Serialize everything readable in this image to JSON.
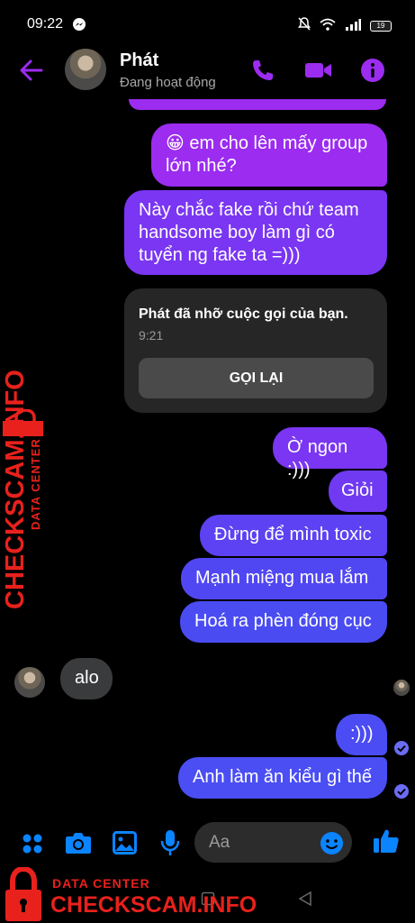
{
  "status_bar": {
    "time": "09:22",
    "battery": "19"
  },
  "header": {
    "contact_name": "Phát",
    "contact_status": "Đang hoạt động"
  },
  "messages": {
    "m1_line1": "😀 em cho lên mấy group",
    "m1_line2": "lớn nhé?",
    "m2_line1": "Này chắc fake rồi chứ team",
    "m2_line2": "handsome boy làm gì có",
    "m2_line3": "tuyển ng fake ta =)))",
    "m3": "Ờ ngon :)))",
    "m4": "Giỏi",
    "m5": "Đừng để mình toxic",
    "m6": "Mạnh miệng mua lắm",
    "m7": "Hoá ra phèn đóng cục",
    "m8": "alo",
    "m9": ":)))",
    "m10": "Anh làm ăn kiểu gì thế"
  },
  "missed_call": {
    "title": "Phát đã nhỡ cuộc gọi của bạn.",
    "time": "9:21",
    "button": "GỌI LẠI"
  },
  "composer": {
    "placeholder": "Aa"
  },
  "watermark": {
    "label_small": "DATA CENTER",
    "label_big": "CHECKSCAM.INFO"
  },
  "colors": {
    "accent": "#9b2cf0",
    "link": "#0a84ff",
    "watermark": "#e8211c"
  }
}
